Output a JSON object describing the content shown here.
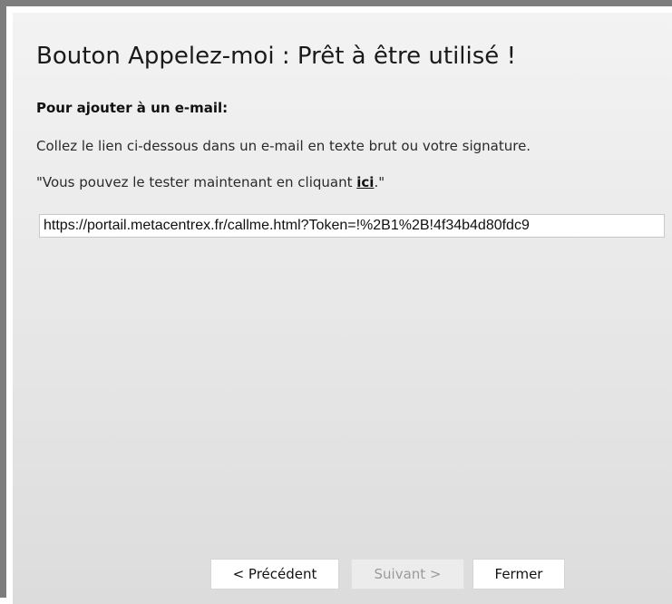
{
  "dialog": {
    "title": "Bouton Appelez-moi : Prêt à être utilisé !",
    "section_heading": "Pour ajouter à un e-mail:",
    "instruction": "Collez le lien ci-dessous dans un e-mail en texte brut ou votre signature.",
    "test_prefix": "\"Vous pouvez le tester maintenant en cliquant ",
    "test_link": "ici",
    "test_suffix": ".\"",
    "url_value": "https://portail.metacentrex.fr/callme.html?Token=!%2B1%2B!4f34b4d80fdc9"
  },
  "buttons": {
    "previous": "< Précédent",
    "next": "Suivant >",
    "close": "Fermer"
  }
}
